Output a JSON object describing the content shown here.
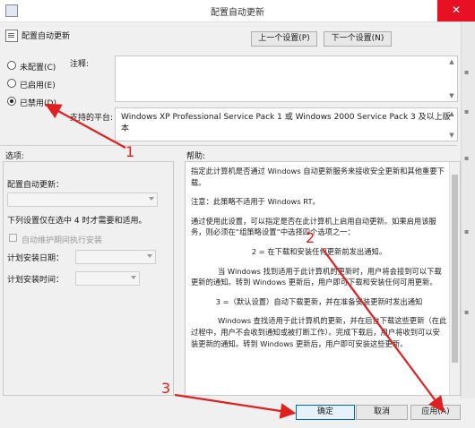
{
  "window": {
    "title": "配置自动更新",
    "close_glyph": "✕"
  },
  "header": {
    "title": "配置自动更新"
  },
  "nav": {
    "prev_label": "上一个设置(P)",
    "next_label": "下一个设置(N)"
  },
  "state": {
    "options": [
      {
        "label": "未配置(C)",
        "checked": false
      },
      {
        "label": "已启用(E)",
        "checked": false
      },
      {
        "label": "已禁用(D)",
        "checked": true
      }
    ],
    "comment_label": "注释:",
    "platform_label": "支持的平台:",
    "platform_text": "Windows XP Professional Service Pack 1 或 Windows 2000 Service Pack 3 及以上版本"
  },
  "sections": {
    "options_label": "选项:",
    "help_label": "帮助:"
  },
  "options_panel": {
    "configure_label": "配置自动更新：",
    "note": "下列设置仅在选中 4 时才需要和适用。",
    "maintenance_checkbox": "自动维护期间执行安装",
    "day_label": "计划安装日期：",
    "time_label": "计划安装时间："
  },
  "help": {
    "paragraphs": [
      {
        "text": "指定此计算机是否通过 Windows 自动更新服务来接收安全更新和其他重要下载。",
        "style": ""
      },
      {
        "text": "注意：此策略不适用于 Windows RT。",
        "style": ""
      },
      {
        "text": "通过使用此设置，可以指定是否在此计算机上启用自动更新。如果启用该服务，则必须在“组策略设置”中选择四个选项之一：",
        "style": ""
      },
      {
        "text": "2 = 在下载和安装任何更新前发出通知。",
        "style": "c"
      },
      {
        "text": "当 Windows 找到适用于此计算机的更新时，用户将会接到可以下载更新的通知。转到 Windows 更新后，用户即可下载和安装任何可用更新。",
        "style": "i"
      },
      {
        "text": "3 =（默认设置）自动下载更新，并在准备安装更新时发出通知",
        "style": "c"
      },
      {
        "text": "Windows 查找适用于此计算机的更新，并在后台下载这些更新（在此过程中，用户不会收到通知或被打断工作）。完成下载后，用户将收到可以安装更新的通知。转到 Windows 更新后，用户即可安装这些更新。",
        "style": "i"
      }
    ]
  },
  "footer": {
    "ok_label": "确定",
    "cancel_label": "取消",
    "apply_label": "应用(A)"
  },
  "annotations": {
    "one": "1",
    "two": "2",
    "three": "3"
  },
  "colors": {
    "annotation": "#e02020",
    "close_button": "#e81123",
    "primary_border": "#0a64ad"
  }
}
